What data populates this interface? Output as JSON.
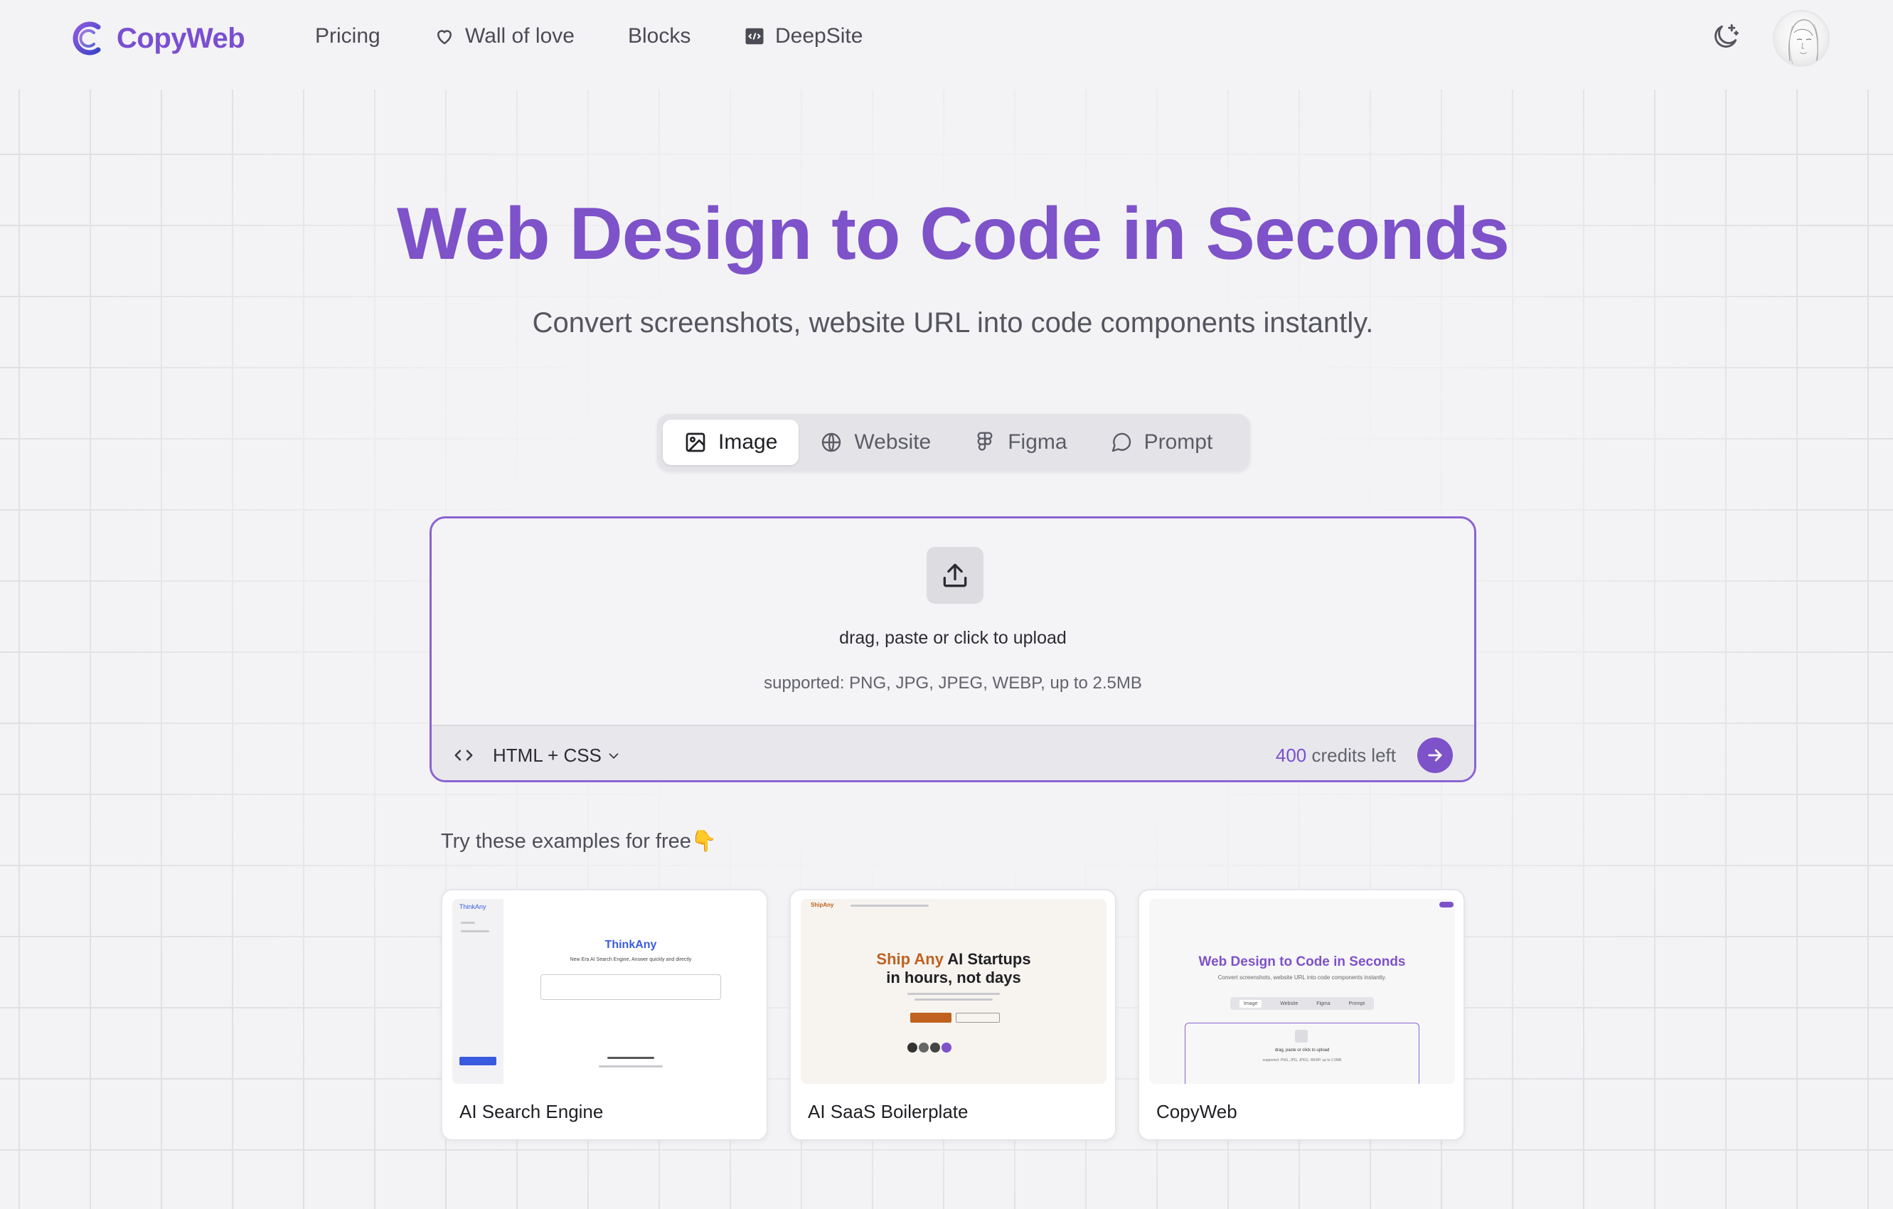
{
  "brand": {
    "name": "CopyWeb",
    "accent": "#7e52c9"
  },
  "nav": {
    "links": [
      {
        "label": "Pricing",
        "icon": ""
      },
      {
        "label": "Wall of love",
        "icon": "heart-icon"
      },
      {
        "label": "Blocks",
        "icon": ""
      },
      {
        "label": "DeepSite",
        "icon": "code-window-icon"
      }
    ],
    "theme_icon": "moon-sparkle-icon"
  },
  "hero": {
    "title": "Web Design to Code in Seconds",
    "subtitle": "Convert screenshots, website URL into code components instantly."
  },
  "tabs": [
    {
      "label": "Image",
      "icon": "image-icon",
      "active": true
    },
    {
      "label": "Website",
      "icon": "globe-icon",
      "active": false
    },
    {
      "label": "Figma",
      "icon": "figma-icon",
      "active": false
    },
    {
      "label": "Prompt",
      "icon": "chat-bubble-icon",
      "active": false
    }
  ],
  "upload": {
    "prompt": "drag, paste or click to upload",
    "supported": "supported: PNG, JPG, JPEG, WEBP, up to 2.5MB",
    "format": "HTML + CSS",
    "credits_count": "400",
    "credits_suffix": "credits left"
  },
  "examples": {
    "label": "Try these examples for free👇",
    "cards": [
      {
        "label": "AI Search Engine",
        "thumb": {
          "brand": "ThinkAny",
          "tagline": "New Era AI Search Engine, Answer quickly and directly"
        }
      },
      {
        "label": "AI SaaS Boilerplate",
        "thumb": {
          "brand": "ShipAny",
          "title_accent": "Ship Any",
          "title_rest": "AI Startups",
          "title_line2": "in hours, not days"
        }
      },
      {
        "label": "CopyWeb",
        "thumb": {
          "title": "Web Design to Code in Seconds",
          "subtitle": "Convert screenshots, website URL into code components instantly.",
          "tabs": [
            "Image",
            "Website",
            "Figma",
            "Prompt"
          ],
          "upload_text": "drag, paste or click to upload",
          "hint": "supported: PNG, JPG, JPEG, WEBP, up to 2.5MB"
        }
      }
    ]
  }
}
